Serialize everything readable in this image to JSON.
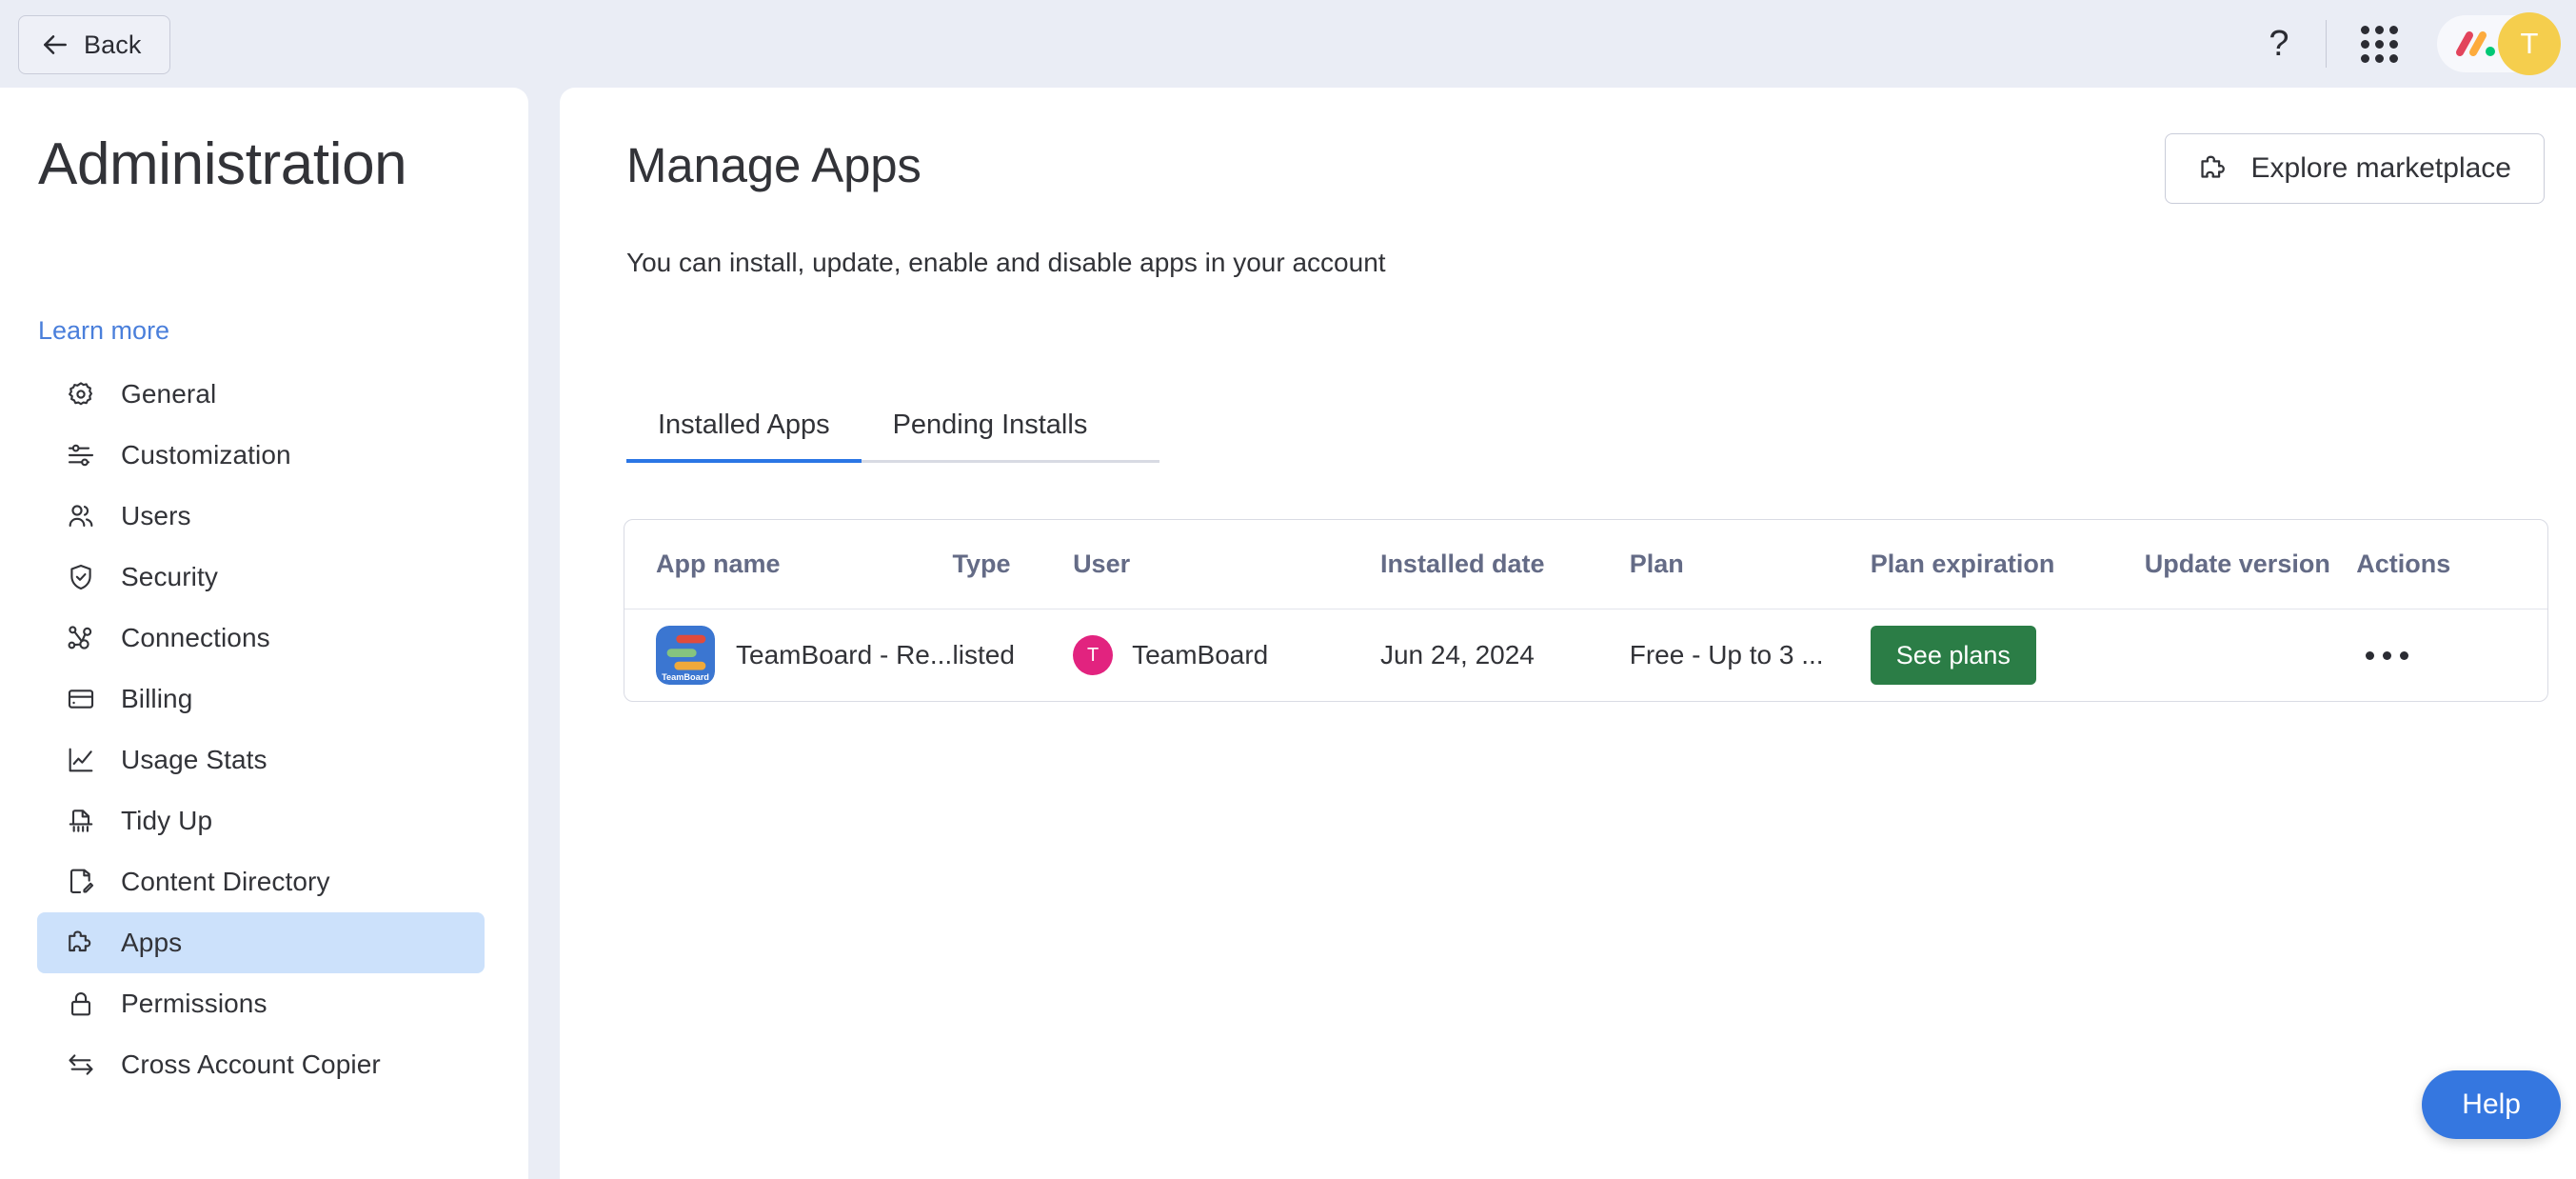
{
  "topbar": {
    "back_label": "Back",
    "help_icon": "question-mark-icon",
    "apps_grid_icon": "apps-grid-icon",
    "brand_logo": "monday-logo",
    "avatar_initial": "T"
  },
  "sidebar": {
    "title": "Administration",
    "learn_more": "Learn more",
    "items": [
      {
        "label": "General",
        "icon": "gear-icon",
        "active": false
      },
      {
        "label": "Customization",
        "icon": "sliders-icon",
        "active": false
      },
      {
        "label": "Users",
        "icon": "users-icon",
        "active": false
      },
      {
        "label": "Security",
        "icon": "shield-check-icon",
        "active": false
      },
      {
        "label": "Connections",
        "icon": "connections-icon",
        "active": false
      },
      {
        "label": "Billing",
        "icon": "credit-card-icon",
        "active": false
      },
      {
        "label": "Usage Stats",
        "icon": "chart-line-icon",
        "active": false
      },
      {
        "label": "Tidy Up",
        "icon": "shredder-icon",
        "active": false
      },
      {
        "label": "Content Directory",
        "icon": "document-edit-icon",
        "active": false
      },
      {
        "label": "Apps",
        "icon": "puzzle-piece-icon",
        "active": true
      },
      {
        "label": "Permissions",
        "icon": "lock-icon",
        "active": false
      },
      {
        "label": "Cross Account Copier",
        "icon": "transfer-arrows-icon",
        "active": false
      }
    ]
  },
  "main": {
    "title": "Manage Apps",
    "subtitle": "You can install, update, enable and disable apps in your account",
    "explore_button": {
      "label": "Explore marketplace",
      "icon": "puzzle-piece-icon"
    },
    "tabs": [
      {
        "label": "Installed Apps",
        "active": true
      },
      {
        "label": "Pending Installs",
        "active": false
      }
    ],
    "table": {
      "columns": [
        "App name",
        "Type",
        "User",
        "Installed date",
        "Plan",
        "Plan expiration",
        "Update version",
        "Actions"
      ],
      "rows": [
        {
          "app_icon": "teamboard-app-icon",
          "app_icon_label": "TeamBoard",
          "app_name": "TeamBoard - Re...",
          "type": "listed",
          "user_initial": "T",
          "user": "TeamBoard",
          "installed_date": "Jun 24, 2024",
          "plan": "Free - Up to 3 ...",
          "plan_expiration_button": "See plans",
          "update_version": "",
          "actions_icon": "kebab-menu-icon"
        }
      ]
    }
  },
  "help_fab": {
    "label": "Help"
  },
  "colors": {
    "page_background": "#eaedf5",
    "panel": "#ffffff",
    "accent_blue": "#2b76e5",
    "link_blue": "#4a7fdb",
    "active_nav": "#cce1fb",
    "see_plans_green": "#2b7d46",
    "help_blue": "#3577e0",
    "avatar_yellow": "#f5ce4d",
    "user_avatar_pink": "#e2237f",
    "table_header_text": "#646b86",
    "border": "#d9dbe4"
  }
}
